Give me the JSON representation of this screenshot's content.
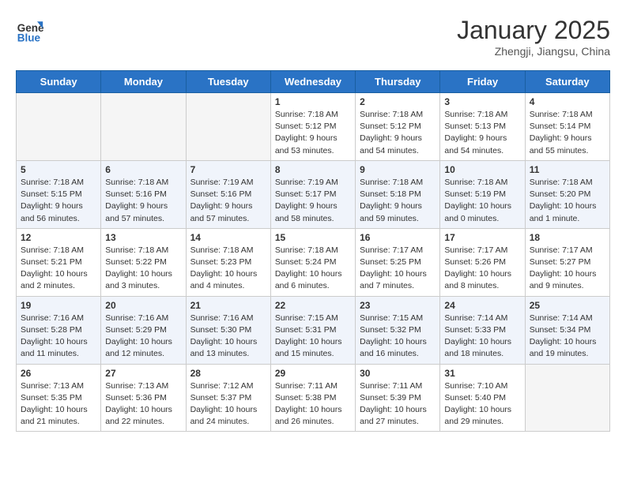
{
  "header": {
    "logo_line1": "General",
    "logo_line2": "Blue",
    "month": "January 2025",
    "location": "Zhengji, Jiangsu, China"
  },
  "weekdays": [
    "Sunday",
    "Monday",
    "Tuesday",
    "Wednesday",
    "Thursday",
    "Friday",
    "Saturday"
  ],
  "weeks": [
    [
      {
        "day": "",
        "content": ""
      },
      {
        "day": "",
        "content": ""
      },
      {
        "day": "",
        "content": ""
      },
      {
        "day": "1",
        "content": "Sunrise: 7:18 AM\nSunset: 5:12 PM\nDaylight: 9 hours\nand 53 minutes."
      },
      {
        "day": "2",
        "content": "Sunrise: 7:18 AM\nSunset: 5:12 PM\nDaylight: 9 hours\nand 54 minutes."
      },
      {
        "day": "3",
        "content": "Sunrise: 7:18 AM\nSunset: 5:13 PM\nDaylight: 9 hours\nand 54 minutes."
      },
      {
        "day": "4",
        "content": "Sunrise: 7:18 AM\nSunset: 5:14 PM\nDaylight: 9 hours\nand 55 minutes."
      }
    ],
    [
      {
        "day": "5",
        "content": "Sunrise: 7:18 AM\nSunset: 5:15 PM\nDaylight: 9 hours\nand 56 minutes."
      },
      {
        "day": "6",
        "content": "Sunrise: 7:18 AM\nSunset: 5:16 PM\nDaylight: 9 hours\nand 57 minutes."
      },
      {
        "day": "7",
        "content": "Sunrise: 7:19 AM\nSunset: 5:16 PM\nDaylight: 9 hours\nand 57 minutes."
      },
      {
        "day": "8",
        "content": "Sunrise: 7:19 AM\nSunset: 5:17 PM\nDaylight: 9 hours\nand 58 minutes."
      },
      {
        "day": "9",
        "content": "Sunrise: 7:18 AM\nSunset: 5:18 PM\nDaylight: 9 hours\nand 59 minutes."
      },
      {
        "day": "10",
        "content": "Sunrise: 7:18 AM\nSunset: 5:19 PM\nDaylight: 10 hours\nand 0 minutes."
      },
      {
        "day": "11",
        "content": "Sunrise: 7:18 AM\nSunset: 5:20 PM\nDaylight: 10 hours\nand 1 minute."
      }
    ],
    [
      {
        "day": "12",
        "content": "Sunrise: 7:18 AM\nSunset: 5:21 PM\nDaylight: 10 hours\nand 2 minutes."
      },
      {
        "day": "13",
        "content": "Sunrise: 7:18 AM\nSunset: 5:22 PM\nDaylight: 10 hours\nand 3 minutes."
      },
      {
        "day": "14",
        "content": "Sunrise: 7:18 AM\nSunset: 5:23 PM\nDaylight: 10 hours\nand 4 minutes."
      },
      {
        "day": "15",
        "content": "Sunrise: 7:18 AM\nSunset: 5:24 PM\nDaylight: 10 hours\nand 6 minutes."
      },
      {
        "day": "16",
        "content": "Sunrise: 7:17 AM\nSunset: 5:25 PM\nDaylight: 10 hours\nand 7 minutes."
      },
      {
        "day": "17",
        "content": "Sunrise: 7:17 AM\nSunset: 5:26 PM\nDaylight: 10 hours\nand 8 minutes."
      },
      {
        "day": "18",
        "content": "Sunrise: 7:17 AM\nSunset: 5:27 PM\nDaylight: 10 hours\nand 9 minutes."
      }
    ],
    [
      {
        "day": "19",
        "content": "Sunrise: 7:16 AM\nSunset: 5:28 PM\nDaylight: 10 hours\nand 11 minutes."
      },
      {
        "day": "20",
        "content": "Sunrise: 7:16 AM\nSunset: 5:29 PM\nDaylight: 10 hours\nand 12 minutes."
      },
      {
        "day": "21",
        "content": "Sunrise: 7:16 AM\nSunset: 5:30 PM\nDaylight: 10 hours\nand 13 minutes."
      },
      {
        "day": "22",
        "content": "Sunrise: 7:15 AM\nSunset: 5:31 PM\nDaylight: 10 hours\nand 15 minutes."
      },
      {
        "day": "23",
        "content": "Sunrise: 7:15 AM\nSunset: 5:32 PM\nDaylight: 10 hours\nand 16 minutes."
      },
      {
        "day": "24",
        "content": "Sunrise: 7:14 AM\nSunset: 5:33 PM\nDaylight: 10 hours\nand 18 minutes."
      },
      {
        "day": "25",
        "content": "Sunrise: 7:14 AM\nSunset: 5:34 PM\nDaylight: 10 hours\nand 19 minutes."
      }
    ],
    [
      {
        "day": "26",
        "content": "Sunrise: 7:13 AM\nSunset: 5:35 PM\nDaylight: 10 hours\nand 21 minutes."
      },
      {
        "day": "27",
        "content": "Sunrise: 7:13 AM\nSunset: 5:36 PM\nDaylight: 10 hours\nand 22 minutes."
      },
      {
        "day": "28",
        "content": "Sunrise: 7:12 AM\nSunset: 5:37 PM\nDaylight: 10 hours\nand 24 minutes."
      },
      {
        "day": "29",
        "content": "Sunrise: 7:11 AM\nSunset: 5:38 PM\nDaylight: 10 hours\nand 26 minutes."
      },
      {
        "day": "30",
        "content": "Sunrise: 7:11 AM\nSunset: 5:39 PM\nDaylight: 10 hours\nand 27 minutes."
      },
      {
        "day": "31",
        "content": "Sunrise: 7:10 AM\nSunset: 5:40 PM\nDaylight: 10 hours\nand 29 minutes."
      },
      {
        "day": "",
        "content": ""
      }
    ]
  ]
}
